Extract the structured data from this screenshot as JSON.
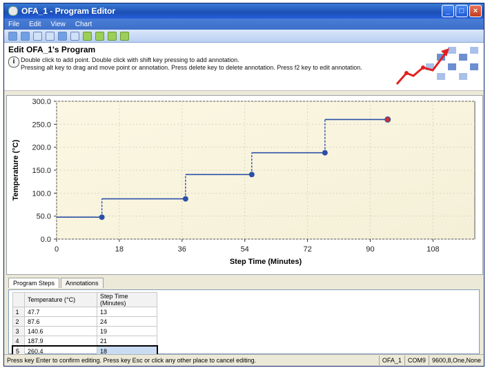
{
  "window": {
    "title": "OFA_1 - Program Editor"
  },
  "menu": [
    "File",
    "Edit",
    "View",
    "Chart"
  ],
  "header": {
    "title": "Edit OFA_1's Program",
    "hint1": "Double click to add point. Double click with shift key pressing to add annotation.",
    "hint2": "Pressing alt key to drag and move point or annotation. Press delete key to delete annotation. Press f2 key to edit annotation."
  },
  "tabs": [
    "Program Steps",
    "Annotations"
  ],
  "table": {
    "columns": [
      "Temperature (°C)",
      "Step Time (Minutes)"
    ],
    "rows": [
      {
        "idx": "1",
        "temp": "47.7",
        "time": "13"
      },
      {
        "idx": "2",
        "temp": "87.6",
        "time": "24"
      },
      {
        "idx": "3",
        "temp": "140.6",
        "time": "19"
      },
      {
        "idx": "4",
        "temp": "187.9",
        "time": "21"
      },
      {
        "idx": "5",
        "temp": "260.4",
        "time": "18"
      }
    ]
  },
  "status": {
    "message": "Press key Enter to confirm editing. Press key Esc or click any other place to cancel editing.",
    "device": "OFA_1",
    "port": "COM9",
    "settings": "9600,8,One,None"
  },
  "chart_data": {
    "type": "line",
    "xlabel": "Step Time (Minutes)",
    "ylabel": "Temperature (°C)",
    "xlim": [
      0,
      120
    ],
    "ylim": [
      0,
      300
    ],
    "xticks": [
      "0",
      "18",
      "36",
      "54",
      "72",
      "90",
      "108"
    ],
    "xtick_values": [
      0,
      18,
      36,
      54,
      72,
      90,
      108
    ],
    "yticks": [
      "0.0",
      "50.0",
      "100.0",
      "150.0",
      "200.0",
      "250.0",
      "300.0"
    ],
    "ytick_values": [
      0,
      50,
      100,
      150,
      200,
      250,
      300
    ],
    "grid": true,
    "steps": [
      {
        "start": 0,
        "end": 13,
        "temp": 47.7
      },
      {
        "start": 13,
        "end": 37,
        "temp": 87.6
      },
      {
        "start": 37,
        "end": 56,
        "temp": 140.6
      },
      {
        "start": 56,
        "end": 77,
        "temp": 187.9
      },
      {
        "start": 77,
        "end": 95,
        "temp": 260.4
      }
    ],
    "line_color": "#2b4fa8",
    "last_point_color": "#c83232"
  }
}
